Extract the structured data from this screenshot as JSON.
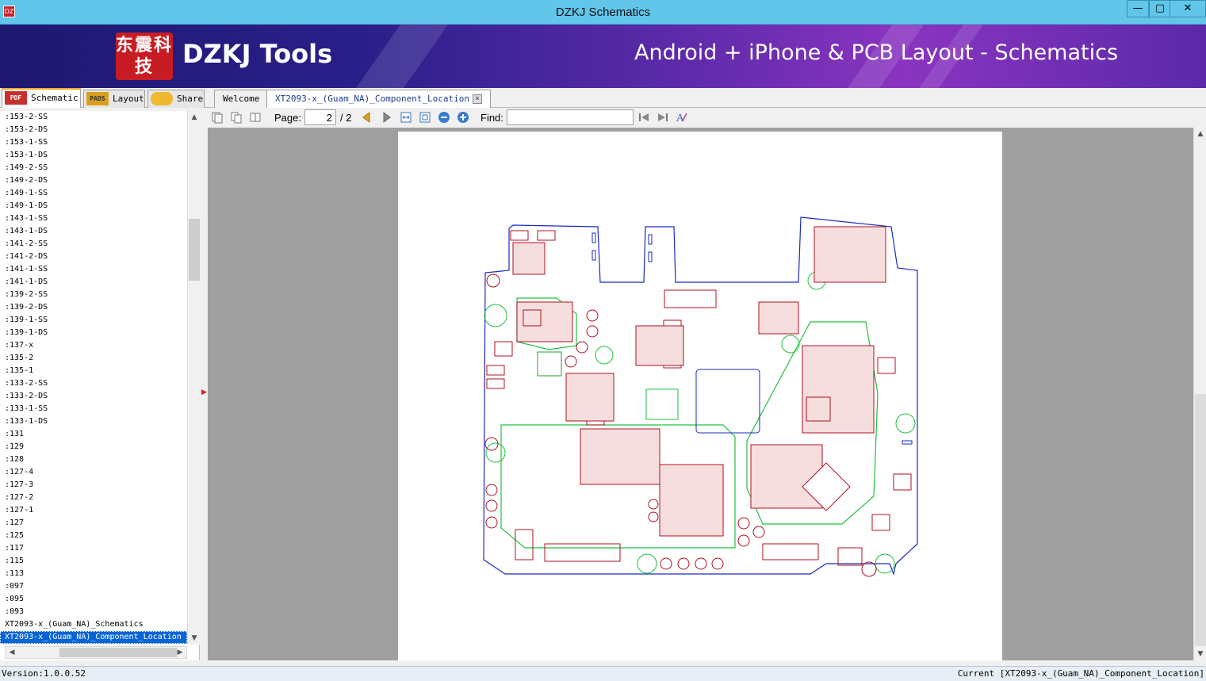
{
  "window": {
    "title": "DZKJ Schematics",
    "minimize": "—",
    "maximize": "▢",
    "close": "✕"
  },
  "banner": {
    "logo_chars": "东震科技",
    "brand": "DZKJ Tools",
    "tagline": "Android + iPhone & PCB Layout - Schematics"
  },
  "left_tabs": [
    {
      "label": "Schematic",
      "icon": "pdf-icon"
    },
    {
      "label": "Layout",
      "icon": "pads-icon"
    },
    {
      "label": "Share",
      "icon": "cloud-share-icon"
    }
  ],
  "doc_tabs": [
    {
      "label": "Welcome"
    },
    {
      "label": "XT2093-x_(Guam_NA)_Component_Location"
    }
  ],
  "files": [
    ":153-2-SS",
    ":153-2-DS",
    ":153-1-SS",
    ":153-1-DS",
    ":149-2-SS",
    ":149-2-DS",
    ":149-1-SS",
    ":149-1-DS",
    ":143-1-SS",
    ":143-1-DS",
    ":141-2-SS",
    ":141-2-DS",
    ":141-1-SS",
    ":141-1-DS",
    ":139-2-SS",
    ":139-2-DS",
    ":139-1-SS",
    ":139-1-DS",
    ":137-x",
    ":135-2",
    ":135-1",
    ":133-2-SS",
    ":133-2-DS",
    ":133-1-SS",
    ":133-1-DS",
    ":131",
    ":129",
    ":128",
    ":127-4",
    ":127-3",
    ":127-2",
    ":127-1",
    ":127",
    ":125",
    ":117",
    ":115",
    ":113",
    ":097",
    ":095",
    ":093",
    "XT2093-x_(Guam_NA)_Schematics",
    "XT2093-x_(Guam_NA)_Component_Location"
  ],
  "selected_file_index": 41,
  "toolbar": {
    "page_label": "Page:",
    "page_current": "2",
    "page_total": "/ 2",
    "find_label": "Find:",
    "find_value": ""
  },
  "status": {
    "version": "Version:1.0.0.52",
    "current": "Current [XT2093-x_(Guam_NA)_Component_Location]"
  }
}
